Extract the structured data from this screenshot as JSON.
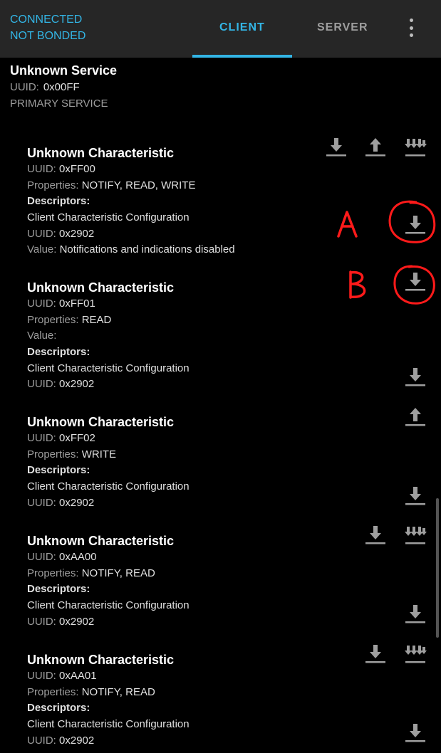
{
  "connection": {
    "status": "CONNECTED",
    "bond": "NOT BONDED"
  },
  "tabs": {
    "client": "CLIENT",
    "server": "SERVER"
  },
  "service": {
    "name": "Unknown Service",
    "uuid_label": "UUID:",
    "uuid": "0x00FF",
    "type": "PRIMARY SERVICE"
  },
  "characteristics": [
    {
      "name": "Unknown Characteristic",
      "uuid": "0xFF00",
      "properties": "NOTIFY, READ, WRITE",
      "descriptor_name": "Client Characteristic Configuration",
      "descriptor_uuid": "0x2902",
      "descriptor_value": "Notifications and indications disabled"
    },
    {
      "name": "Unknown Characteristic",
      "uuid": "0xFF01",
      "properties": "READ",
      "value": "",
      "descriptor_name": "Client Characteristic Configuration",
      "descriptor_uuid": "0x2902"
    },
    {
      "name": "Unknown Characteristic",
      "uuid": "0xFF02",
      "properties": "WRITE",
      "descriptor_name": "Client Characteristic Configuration",
      "descriptor_uuid": "0x2902"
    },
    {
      "name": "Unknown Characteristic",
      "uuid": "0xAA00",
      "properties": "NOTIFY, READ",
      "descriptor_name": "Client Characteristic Configuration",
      "descriptor_uuid": "0x2902"
    },
    {
      "name": "Unknown Characteristic",
      "uuid": "0xAA01",
      "properties": "NOTIFY, READ",
      "descriptor_name": "Client Characteristic Configuration",
      "descriptor_uuid": "0x2902"
    }
  ],
  "labels": {
    "uuid": "UUID:",
    "properties": "Properties:",
    "descriptors": "Descriptors:",
    "value": "Value:"
  },
  "annotations": {
    "a": "A",
    "b": "B"
  },
  "colors": {
    "accent": "#33b5e5",
    "icon": "#9e9e9e",
    "annotation": "#ff1a1a"
  },
  "icons": [
    "download-icon",
    "upload-icon",
    "notify-icon",
    "overflow-menu-icon"
  ]
}
